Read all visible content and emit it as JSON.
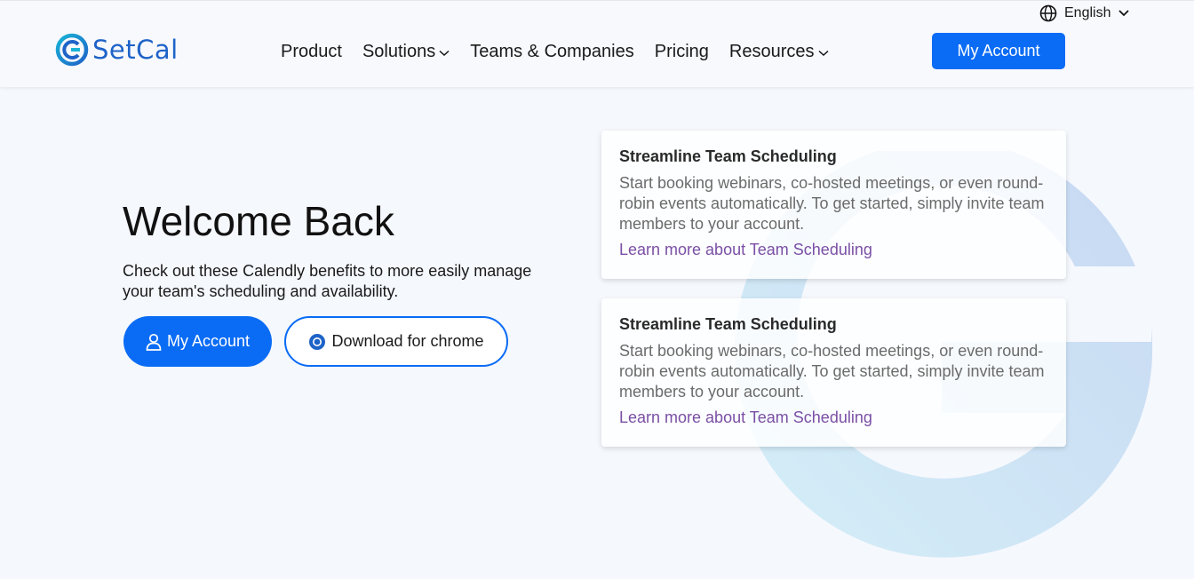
{
  "brand": {
    "name": "SetCal"
  },
  "header": {
    "language": "English",
    "nav": [
      {
        "label": "Product",
        "has_dropdown": false
      },
      {
        "label": "Solutions",
        "has_dropdown": true
      },
      {
        "label": "Teams & Companies",
        "has_dropdown": false
      },
      {
        "label": "Pricing",
        "has_dropdown": false
      },
      {
        "label": "Resources",
        "has_dropdown": true
      }
    ],
    "account_button": "My Account"
  },
  "hero": {
    "title": "Welcome Back",
    "subtitle": "Check out these Calendly benefits to more easily manage your team's scheduling and availability.",
    "primary_button": "My Account",
    "secondary_button": "Download for chrome"
  },
  "cards": [
    {
      "title": "Streamline Team Scheduling",
      "text": "Start booking webinars, co-hosted meetings, or even round-robin events automatically. To get started, simply invite team members to your account.",
      "link": "Learn more about Team Scheduling"
    },
    {
      "title": "Streamline Team Scheduling",
      "text": "Start booking webinars, co-hosted meetings, or even round-robin events automatically. To get started, simply invite team members to your account.",
      "link": "Learn more about Team Scheduling"
    }
  ],
  "colors": {
    "accent": "#0a6cf5",
    "link": "#7a4fa5",
    "brand": "#1e63c8",
    "background": "#f5f8fd"
  },
  "icons": {
    "language": "globe-icon",
    "dropdown": "chevron-down-icon",
    "account": "user-icon",
    "chrome": "chrome-icon",
    "logo": "setcal-logo-icon"
  }
}
